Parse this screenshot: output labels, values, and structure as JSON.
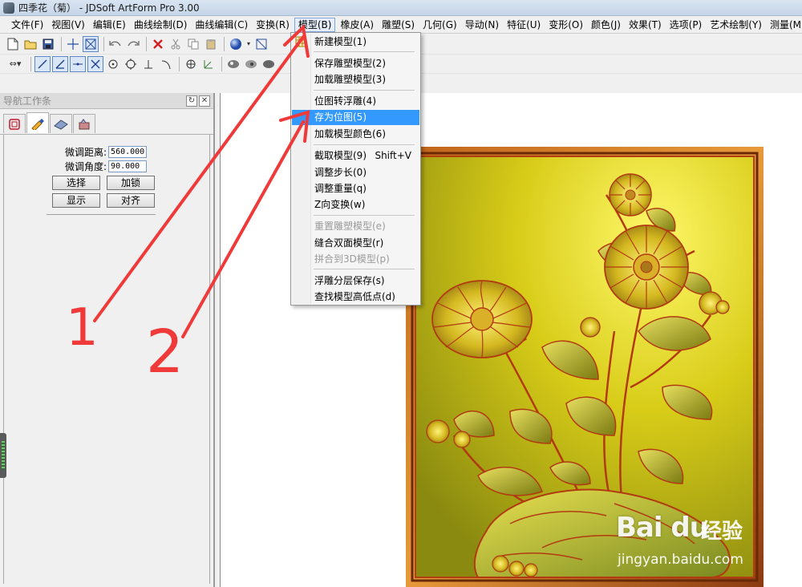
{
  "window": {
    "title": "四季花（菊） - JDSoft ArtForm Pro 3.00"
  },
  "menubar": {
    "items": [
      {
        "label": "文件(F)"
      },
      {
        "label": "视图(V)"
      },
      {
        "label": "编辑(E)"
      },
      {
        "label": "曲线绘制(D)"
      },
      {
        "label": "曲线编辑(C)"
      },
      {
        "label": "变换(R)"
      },
      {
        "label": "模型(B)"
      },
      {
        "label": "橡皮(A)"
      },
      {
        "label": "雕塑(S)"
      },
      {
        "label": "几何(G)"
      },
      {
        "label": "导动(N)"
      },
      {
        "label": "特征(U)"
      },
      {
        "label": "变形(O)"
      },
      {
        "label": "颜色(J)"
      },
      {
        "label": "效果(T)"
      },
      {
        "label": "选项(P)"
      },
      {
        "label": "艺术绘制(Y)"
      },
      {
        "label": "测量(M)"
      }
    ]
  },
  "model_menu": {
    "items": [
      {
        "label": "新建模型(1)"
      },
      {
        "label": "保存雕塑模型(2)"
      },
      {
        "label": "加载雕塑模型(3)"
      },
      {
        "label": "位图转浮雕(4)"
      },
      {
        "label": "存为位图(5)"
      },
      {
        "label": "加载模型颜色(6)"
      },
      {
        "label": "截取模型(9)",
        "shortcut": "Shift+V"
      },
      {
        "label": "调整步长(0)"
      },
      {
        "label": "调整重量(q)"
      },
      {
        "label": "Z向变换(w)"
      },
      {
        "label": "重置雕塑模型(e)"
      },
      {
        "label": "缝合双面模型(r)"
      },
      {
        "label": "拼合到3D模型(p)"
      },
      {
        "label": "浮雕分层保存(s)"
      },
      {
        "label": "查找模型高低点(d)"
      }
    ]
  },
  "nav_panel": {
    "title": "导航工作条",
    "distance_label": "微调距离:",
    "distance_value": "560.000",
    "angle_label": "微调角度:",
    "angle_value": "90.000",
    "btn_select": "选择",
    "btn_lock": "加锁",
    "btn_show": "显示",
    "btn_align": "对齐"
  },
  "annotations": {
    "label_1": "1",
    "label_2": "2"
  },
  "watermark": {
    "logo": "Bai du",
    "jingyan": "经验",
    "url": "jingyan.baidu.com"
  }
}
